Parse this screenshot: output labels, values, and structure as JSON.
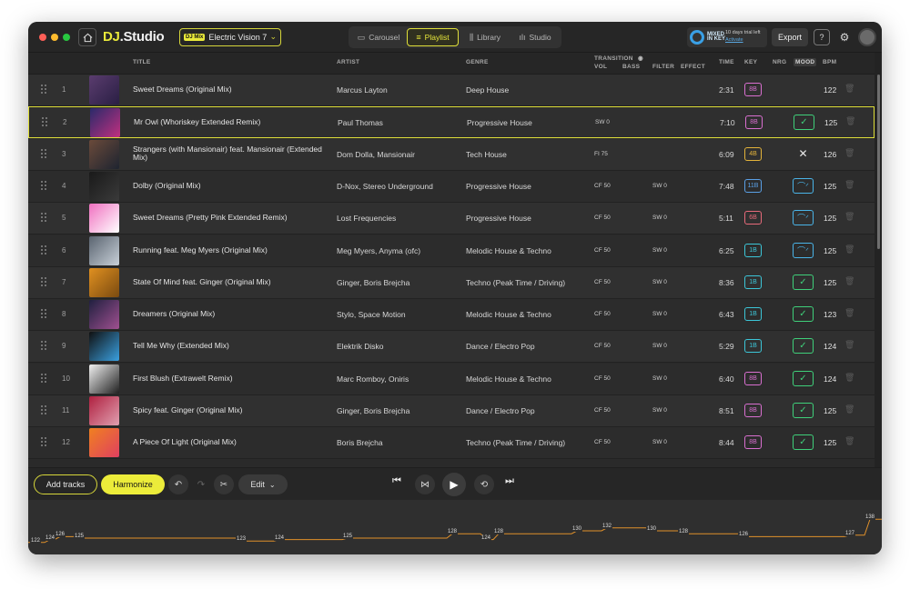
{
  "header": {
    "logo": {
      "dj": "DJ",
      "studio": ".Studio"
    },
    "mix": {
      "badge": "DJ Mix",
      "name": "Electric Vision 7"
    },
    "views": [
      {
        "label": "Carousel",
        "icon": "carousel-icon"
      },
      {
        "label": "Playlist",
        "icon": "playlist-icon",
        "active": true
      },
      {
        "label": "Library",
        "icon": "library-icon"
      },
      {
        "label": "Studio",
        "icon": "waveform-icon"
      }
    ],
    "promo": {
      "brand": "MIXED IN KEY",
      "trial": "10 days trial left",
      "activate": "Activate"
    },
    "export_label": "Export"
  },
  "columns": {
    "title": "TITLE",
    "artist": "ARTIST",
    "genre": "GENRE",
    "transition": "TRANSITION",
    "vol": "VOL",
    "bass": "BASS",
    "filter": "FILTER",
    "effect": "EFFECT",
    "time": "TIME",
    "key": "KEY",
    "nrg": "NRG",
    "mood": "MOOD",
    "bpm": "BPM"
  },
  "tracks": [
    {
      "n": "1",
      "title": "Sweet Dreams (Original Mix)",
      "artist": "Marcus Layton",
      "genre": "Deep House",
      "trans": "",
      "filter": "",
      "time": "2:31",
      "key": "8B",
      "mood": "none",
      "bpm": "122"
    },
    {
      "n": "2",
      "title": "Mr Owl (Whoriskey Extended Remix)",
      "artist": "Paul Thomas",
      "genre": "Progressive House",
      "trans": "SW 0",
      "filter": "",
      "time": "7:10",
      "key": "8B",
      "mood": "check",
      "bpm": "125",
      "selected": true
    },
    {
      "n": "3",
      "title": "Strangers (with Mansionair) feat. Mansionair (Extended Mix)",
      "artist": "Dom Dolla, Mansionair",
      "genre": "Tech House",
      "trans": "FI 75",
      "filter": "",
      "time": "6:09",
      "key": "4B",
      "mood": "cross",
      "bpm": "126"
    },
    {
      "n": "4",
      "title": "Dolby (Original Mix)",
      "artist": "D-Nox, Stereo Underground",
      "genre": "Progressive House",
      "trans": "CF 50",
      "filter": "SW 0",
      "time": "7:48",
      "key": "11B",
      "mood": "wave",
      "bpm": "125"
    },
    {
      "n": "5",
      "title": "Sweet Dreams (Pretty Pink Extended Remix)",
      "artist": "Lost Frequencies",
      "genre": "Progressive House",
      "trans": "CF 50",
      "filter": "SW 0",
      "time": "5:11",
      "key": "6B",
      "mood": "wave",
      "bpm": "125"
    },
    {
      "n": "6",
      "title": "Running feat. Meg Myers (Original Mix)",
      "artist": "Meg Myers, Anyma (ofc)",
      "genre": "Melodic House & Techno",
      "trans": "CF 50",
      "filter": "SW 0",
      "time": "6:25",
      "key": "1B",
      "mood": "wave",
      "bpm": "125"
    },
    {
      "n": "7",
      "title": "State Of Mind feat. Ginger (Original Mix)",
      "artist": "Ginger, Boris Brejcha",
      "genre": "Techno (Peak Time / Driving)",
      "trans": "CF 50",
      "filter": "SW 0",
      "time": "8:36",
      "key": "1B",
      "mood": "check",
      "bpm": "125"
    },
    {
      "n": "8",
      "title": "Dreamers (Original Mix)",
      "artist": "Stylo, Space Motion",
      "genre": "Melodic House & Techno",
      "trans": "CF 50",
      "filter": "SW 0",
      "time": "6:43",
      "key": "1B",
      "mood": "check",
      "bpm": "123"
    },
    {
      "n": "9",
      "title": "Tell Me Why (Extended Mix)",
      "artist": "Elektrik Disko",
      "genre": "Dance / Electro Pop",
      "trans": "CF 50",
      "filter": "SW 0",
      "time": "5:29",
      "key": "1B",
      "mood": "check",
      "bpm": "124"
    },
    {
      "n": "10",
      "title": "First Blush (Extrawelt Remix)",
      "artist": "Marc Romboy, Oniris",
      "genre": "Melodic House & Techno",
      "trans": "CF 50",
      "filter": "SW 0",
      "time": "6:40",
      "key": "8B",
      "mood": "check",
      "bpm": "124"
    },
    {
      "n": "11",
      "title": "Spicy feat. Ginger (Original Mix)",
      "artist": "Ginger, Boris Brejcha",
      "genre": "Dance / Electro Pop",
      "trans": "CF 50",
      "filter": "SW 0",
      "time": "8:51",
      "key": "8B",
      "mood": "check",
      "bpm": "125"
    },
    {
      "n": "12",
      "title": "A Piece Of Light (Original Mix)",
      "artist": "Boris Brejcha",
      "genre": "Techno (Peak Time / Driving)",
      "trans": "CF 50",
      "filter": "SW 0",
      "time": "8:44",
      "key": "8B",
      "mood": "check",
      "bpm": "125"
    }
  ],
  "key_colors": {
    "8B": "#d96fd0",
    "4B": "#e3b33a",
    "11B": "#5aa0e6",
    "6B": "#e86a7a",
    "1B": "#3cc6d8"
  },
  "mood_colors": {
    "check": "#3fd07a",
    "wave": "#4ab4e8"
  },
  "controls": {
    "add_tracks": "Add tracks",
    "harmonize": "Harmonize",
    "edit": "Edit"
  },
  "bpm_timeline": [
    "122",
    "124",
    "126",
    "125",
    "123",
    "124",
    "125",
    "128",
    "124",
    "128",
    "130",
    "132",
    "130",
    "128",
    "126",
    "127",
    "138"
  ],
  "accent": "#e8e83a"
}
